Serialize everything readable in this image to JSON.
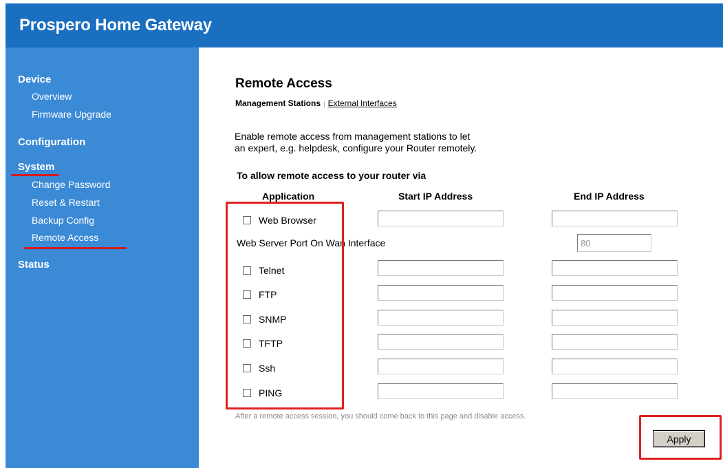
{
  "header": {
    "title": "Prospero Home Gateway"
  },
  "sidebar": {
    "device": "Device",
    "overview": "Overview",
    "firmware_upgrade": "Firmware Upgrade",
    "configuration": "Configuration",
    "system": "System",
    "change_password": "Change Password",
    "reset_restart": "Reset & Restart",
    "backup_config": "Backup Config",
    "remote_access": "Remote Access",
    "status": "Status"
  },
  "main": {
    "title": "Remote Access",
    "tabs": {
      "active": "Management Stations",
      "separator": "|",
      "other": "External Interfaces"
    },
    "description_line1": "Enable remote access from management stations to let",
    "description_line2": "an expert, e.g. helpdesk, configure your Router remotely.",
    "subheading": "To allow remote access to your router via",
    "columns": {
      "application": "Application",
      "start_ip": "Start IP Address",
      "end_ip": "End IP Address"
    },
    "apps": {
      "web_browser": "Web Browser",
      "telnet": "Telnet",
      "ftp": "FTP",
      "snmp": "SNMP",
      "tftp": "TFTP",
      "ssh": "Ssh",
      "ping": "PING"
    },
    "web_server_port_label": "Web Server Port On Wan Interface",
    "web_server_port_value": "80",
    "note": "After a remote access session, you should come back to this page and disable access.",
    "apply_label": "Apply"
  },
  "colors": {
    "header": "#1a6fc0",
    "sidebar": "#3b8ad6",
    "highlight": "#e02020"
  }
}
